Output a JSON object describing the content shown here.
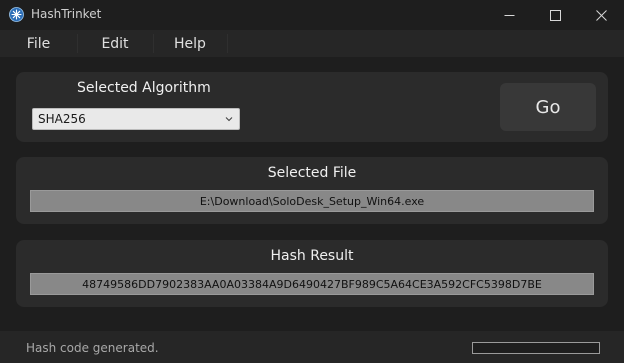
{
  "window": {
    "title": "HashTrinket",
    "icon": "hashtrinket-app-icon"
  },
  "menu": {
    "items": [
      {
        "label": "File"
      },
      {
        "label": "Edit"
      },
      {
        "label": "Help"
      }
    ]
  },
  "algorithm": {
    "label": "Selected Algorithm",
    "selected": "SHA256",
    "go_label": "Go"
  },
  "file": {
    "label": "Selected File",
    "path": "E:\\Download\\SoloDesk_Setup_Win64.exe"
  },
  "hash": {
    "label": "Hash Result",
    "value": "48749586DD7902383AA0A03384A9D6490427BF989C5A64CE3A592CFC5398D7BE"
  },
  "status": {
    "message": "Hash code generated.",
    "progress": 0
  },
  "colors": {
    "background": "#1e1e1e",
    "panel": "#2b2b2b",
    "accent_icon": "#6aa8e8"
  }
}
